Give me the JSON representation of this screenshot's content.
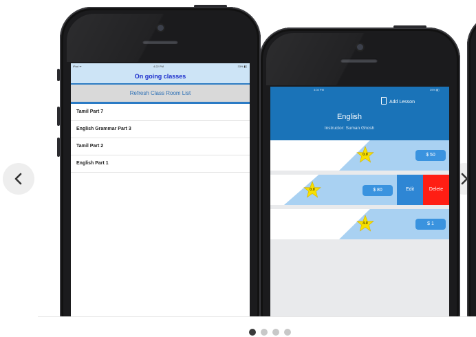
{
  "carousel": {
    "prev_icon": "chevron-left-icon",
    "next_icon": "chevron-right-icon",
    "pages": 4,
    "active_page": 1
  },
  "phone1": {
    "status": {
      "carrier": "iPad ᯤ",
      "time": "4:22 PM",
      "battery": "33% ▮▯"
    },
    "title": "On going classes",
    "refresh_button": "Refresh Class Room List",
    "classes": [
      "Tamil Part 7",
      "English Grammar Part 3",
      "Tamil Part 2",
      "English Part 1"
    ]
  },
  "phone2": {
    "status": {
      "time": "4:04 PM",
      "battery": "39% ▮▯"
    },
    "add_lesson": "Add Lesson",
    "subject": "English",
    "instructor": "Instructor: Suman Ghosh",
    "lessons": [
      {
        "rating": "0.0",
        "price": "$ 50"
      },
      {
        "rating": "0.0",
        "price": "$ 80",
        "edit": "Edit",
        "delete": "Delete"
      },
      {
        "rating": "4.0",
        "price": "$ 1"
      }
    ],
    "colors": {
      "header": "#1a73b8",
      "band": "#a9d1f2",
      "price": "#3a93df",
      "delete": "#ff1e14",
      "edit": "#2e86d4",
      "star": "#f6e000"
    }
  }
}
